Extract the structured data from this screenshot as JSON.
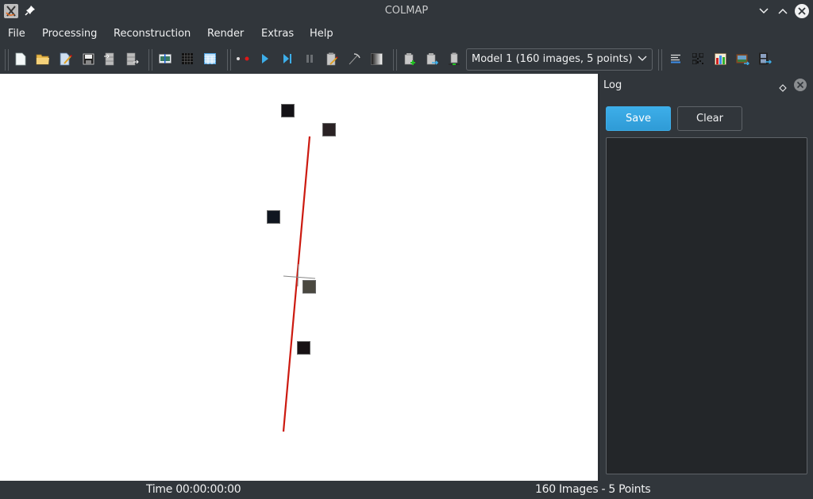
{
  "window": {
    "title": "COLMAP"
  },
  "menubar": {
    "items": [
      "File",
      "Processing",
      "Reconstruction",
      "Render",
      "Extras",
      "Help"
    ]
  },
  "toolbar": {
    "groups": [
      [
        "new-project",
        "open-project",
        "edit-project",
        "save-project",
        "import-model",
        "export-model"
      ],
      [
        "feature-extraction",
        "feature-matching",
        "database-management"
      ],
      [
        "automatic-reconstruction",
        "start-reconstruction",
        "step-reconstruction",
        "pause-reconstruction",
        "reconstruction-options",
        "bundle-adjustment",
        "dense-reconstruction"
      ],
      [
        "import-model-add",
        "export-model-as",
        "export-all-models"
      ],
      [
        "render-options"
      ],
      [
        "log-toggle",
        "match-matrix",
        "model-stats",
        "grab-image",
        "grab-movie"
      ]
    ],
    "model_selector": {
      "selected": "Model 1 (160 images, 5 points)"
    }
  },
  "viewport": {
    "cameras": [
      {
        "color": "#141216"
      },
      {
        "color": "#2a2224"
      },
      {
        "color": "#101620"
      },
      {
        "color": "#4a4840"
      },
      {
        "color": "#171214"
      }
    ],
    "track_color": "#cc1a10"
  },
  "log_panel": {
    "title": "Log",
    "save_label": "Save",
    "clear_label": "Clear",
    "content": ""
  },
  "statusbar": {
    "time": "Time 00:00:00:00",
    "counts": "160 Images - 5 Points"
  }
}
